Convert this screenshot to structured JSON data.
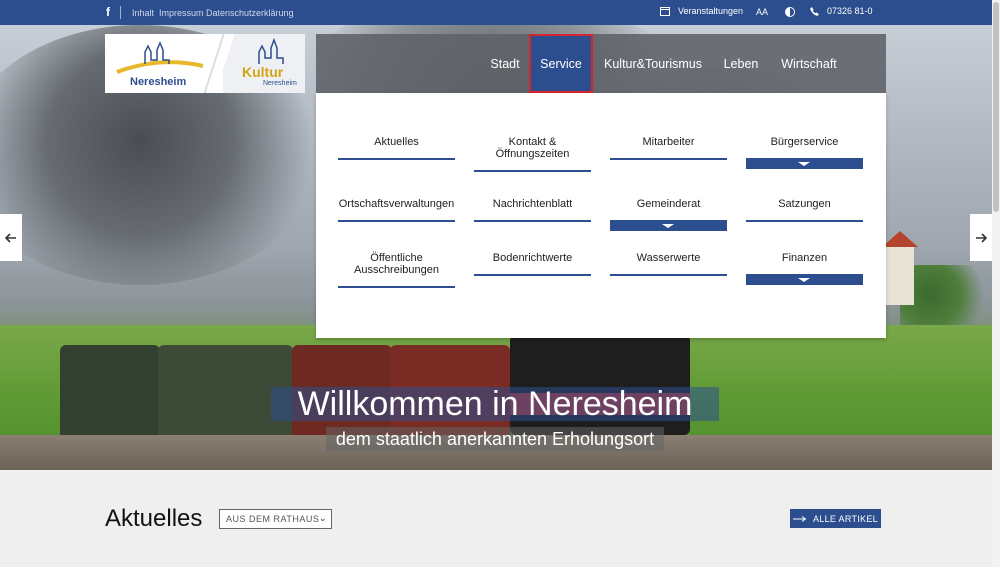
{
  "topbar": {
    "facebook": "f",
    "links": [
      "Inhalt",
      "Impressum",
      "Datenschutzerklärung"
    ],
    "events_label": "Veranstaltungen",
    "fontsize_label": "AA",
    "phone": "07326 81-0"
  },
  "logo": {
    "left_name": "Neresheim",
    "right_name": "Kultur",
    "right_sub": "Neresheim"
  },
  "nav": {
    "items": [
      "Stadt",
      "Service",
      "Kultur&Tourismus",
      "Leben",
      "Wirtschaft"
    ],
    "active": "Service"
  },
  "dropdown": {
    "items": [
      "Aktuelles",
      "Kontakt & Öffnungszeiten",
      "Mitarbeiter",
      "Bürgerservice",
      "Ortschaftsverwaltungen",
      "Nachrichtenblatt",
      "Gemeinderat",
      "Satzungen",
      "Öffentliche Ausschreibungen",
      "Bodenrichtwerte",
      "Wasserwerte",
      "Finanzen"
    ]
  },
  "hero": {
    "title": "Willkommen in Neresheim",
    "subtitle": "dem staatlich anerkannten Erholungsort"
  },
  "news": {
    "heading": "Aktuelles",
    "filter_value": "AUS DEM RATHAUS",
    "all_button": "ALLE ARTIKEL"
  },
  "colors": {
    "primary": "#2d4e8e",
    "highlight": "#d6262c",
    "gold": "#d3a414"
  },
  "icons": {
    "calendar": "calendar-icon",
    "font_size": "font-size-icon",
    "contrast": "contrast-icon",
    "phone": "phone-icon",
    "arrow_left": "arrow-left-icon",
    "arrow_right": "arrow-right-icon"
  }
}
